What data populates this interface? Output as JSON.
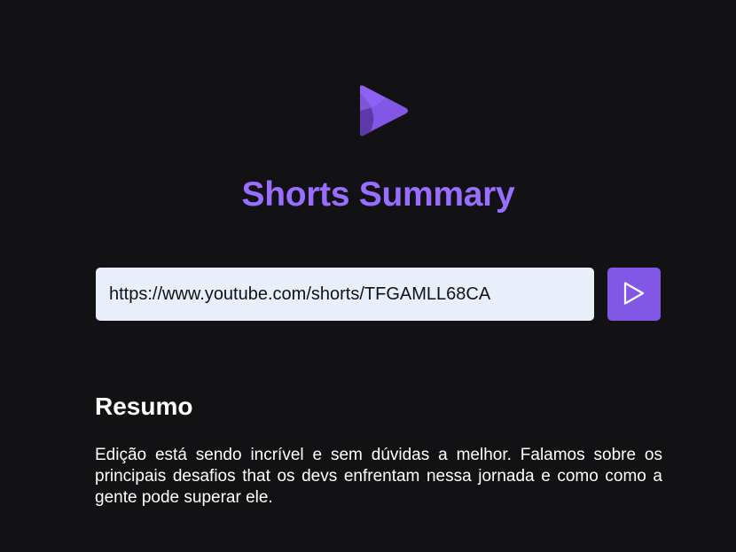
{
  "colors": {
    "background": "#121214",
    "accent": "#8257e5",
    "title": "#996dff",
    "input_background": "#e8effb",
    "text": "#ffffff"
  },
  "header": {
    "logo_icon": "play-triangle-logo-icon",
    "title": "Shorts Summary"
  },
  "search": {
    "value": "https://www.youtube.com/shorts/TFGAMLL68CA",
    "button_icon": "play-icon"
  },
  "summary": {
    "heading": "Resumo",
    "text": "Edição está sendo incrível e sem dúvidas a melhor. Falamos sobre os principais desafios that os devs enfrentam nessa jornada e como como a gente pode superar ele."
  }
}
